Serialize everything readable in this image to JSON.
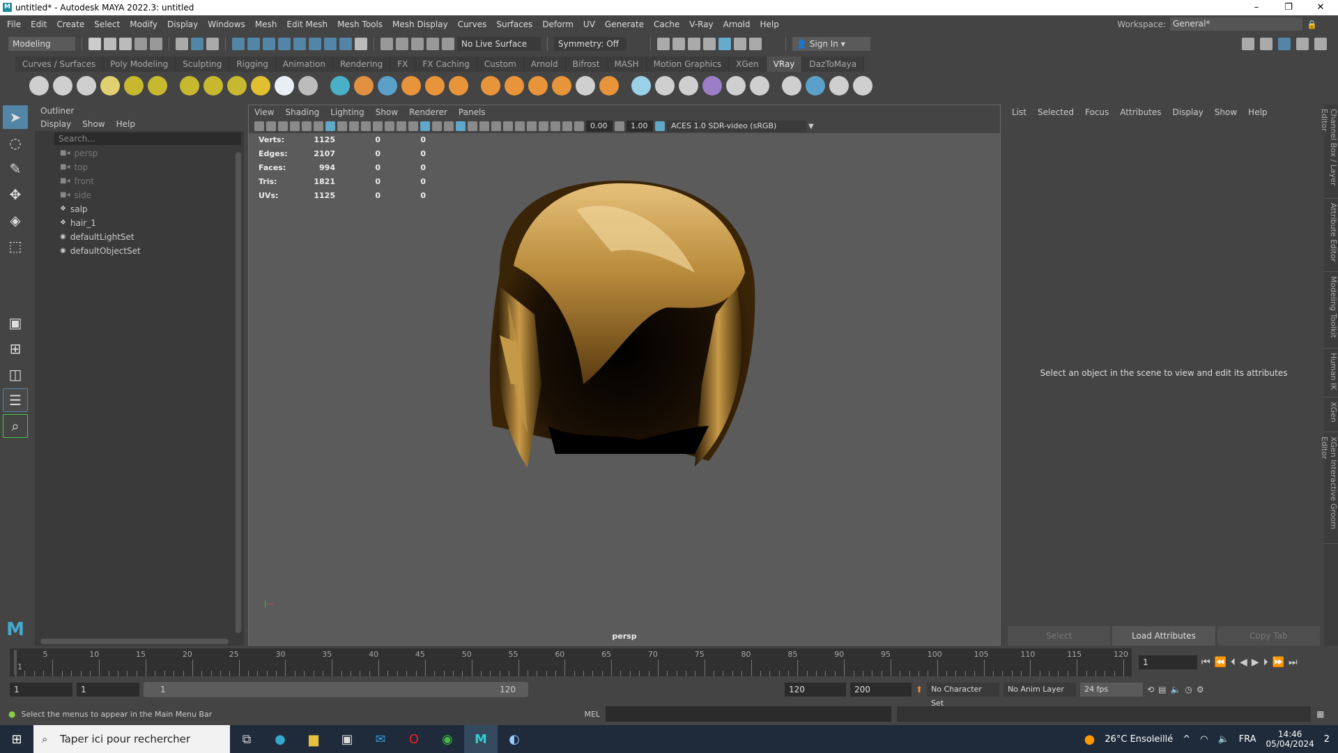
{
  "window": {
    "title": "untitled* - Autodesk MAYA 2022.3: untitled",
    "minimize": "–",
    "maximize": "❐",
    "close": "✕"
  },
  "menubar": [
    "File",
    "Edit",
    "Create",
    "Select",
    "Modify",
    "Display",
    "Windows",
    "Mesh",
    "Edit Mesh",
    "Mesh Tools",
    "Mesh Display",
    "Curves",
    "Surfaces",
    "Deform",
    "UV",
    "Generate",
    "Cache",
    "V-Ray",
    "Arnold",
    "Help"
  ],
  "workspace": {
    "label": "Workspace:",
    "value": "General*"
  },
  "statusline": {
    "mode": "Modeling",
    "live_surface": "No Live Surface",
    "symmetry": "Symmetry: Off",
    "sign_in": "Sign In"
  },
  "shelf_tabs": [
    "Curves / Surfaces",
    "Poly Modeling",
    "Sculpting",
    "Rigging",
    "Animation",
    "Rendering",
    "FX",
    "FX Caching",
    "Custom",
    "Arnold",
    "Bifrost",
    "MASH",
    "Motion Graphics",
    "XGen",
    "VRay",
    "DazToMaya"
  ],
  "active_shelf_tab": "VRay",
  "shelf_colors": [
    "#cfcfcf",
    "#cfcfcf",
    "#cfcfcf",
    "#e0d070",
    "#c8b830",
    "#c8b830",
    "#c8b830",
    "#c8b830",
    "#c8b830",
    "#e0c030",
    "#e8eef4",
    "#bcbcbc",
    "#4ab0c8",
    "#e09040",
    "#5aa0c8",
    "#e8943a",
    "#e8943a",
    "#e8943a",
    "#e8943a",
    "#e8943a",
    "#e8943a",
    "#e8943a",
    "#cfcfcf",
    "#e8943a",
    "#9ad0e8",
    "#cfcfcf",
    "#cfcfcf",
    "#9c7ec8",
    "#cfcfcf",
    "#cfcfcf",
    "#cfcfcf",
    "#5aa0c8",
    "#cfcfcf",
    "#cfcfcf"
  ],
  "outliner": {
    "title": "Outliner",
    "menus": [
      "Display",
      "Show",
      "Help"
    ],
    "search_placeholder": "Search...",
    "items": [
      {
        "label": "persp",
        "icon": "camera-icon",
        "dim": true
      },
      {
        "label": "top",
        "icon": "camera-icon",
        "dim": true
      },
      {
        "label": "front",
        "icon": "camera-icon",
        "dim": true
      },
      {
        "label": "side",
        "icon": "camera-icon",
        "dim": true
      },
      {
        "label": "salp",
        "icon": "transform-icon",
        "dim": false
      },
      {
        "label": "hair_1",
        "icon": "transform-icon",
        "dim": false
      },
      {
        "label": "defaultLightSet",
        "icon": "set-icon",
        "dim": false
      },
      {
        "label": "defaultObjectSet",
        "icon": "set-icon",
        "dim": false
      }
    ]
  },
  "viewport": {
    "menus": [
      "View",
      "Shading",
      "Lighting",
      "Show",
      "Renderer",
      "Panels"
    ],
    "exposure": "0.00",
    "gamma": "1.00",
    "color_space": "ACES 1.0 SDR-video (sRGB)",
    "camera": "persp",
    "hud": [
      {
        "label": "Verts:",
        "v": "1125",
        "a": "0",
        "b": "0"
      },
      {
        "label": "Edges:",
        "v": "2107",
        "a": "0",
        "b": "0"
      },
      {
        "label": "Faces:",
        "v": "994",
        "a": "0",
        "b": "0"
      },
      {
        "label": "Tris:",
        "v": "1821",
        "a": "0",
        "b": "0"
      },
      {
        "label": "UVs:",
        "v": "1125",
        "a": "0",
        "b": "0"
      }
    ]
  },
  "attribute_editor": {
    "menus": [
      "List",
      "Selected",
      "Focus",
      "Attributes",
      "Display",
      "Show",
      "Help"
    ],
    "message": "Select an object in the scene to view and edit its attributes",
    "select": "Select",
    "load": "Load Attributes",
    "copy": "Copy Tab"
  },
  "right_tabs": [
    "Channel Box / Layer Editor",
    "Attribute Editor",
    "Modeling Toolkit",
    "Human IK",
    "XGen",
    "XGen Interactive Groom Editor"
  ],
  "timeline": {
    "ticks": [
      "1",
      "5",
      "10",
      "15",
      "20",
      "25",
      "30",
      "35",
      "40",
      "45",
      "50",
      "55",
      "60",
      "65",
      "70",
      "75",
      "80",
      "85",
      "90",
      "95",
      "100",
      "105",
      "110",
      "115",
      "120"
    ],
    "current_frame": "1"
  },
  "range": {
    "start": "1",
    "playback_start": "1",
    "slider_start": "1",
    "slider_end": "120",
    "playback_end": "120",
    "end": "200",
    "character_set": "No Character Set",
    "anim_layer": "No Anim Layer",
    "fps": "24 fps"
  },
  "commandline": {
    "help": "Select the menus to appear in the Main Menu Bar",
    "lang": "MEL"
  },
  "taskbar": {
    "search": "Taper ici pour rechercher",
    "weather": "26°C  Ensoleillé",
    "lang": "FRA",
    "time": "14:46",
    "date": "05/04/2024",
    "notifications": "2"
  }
}
